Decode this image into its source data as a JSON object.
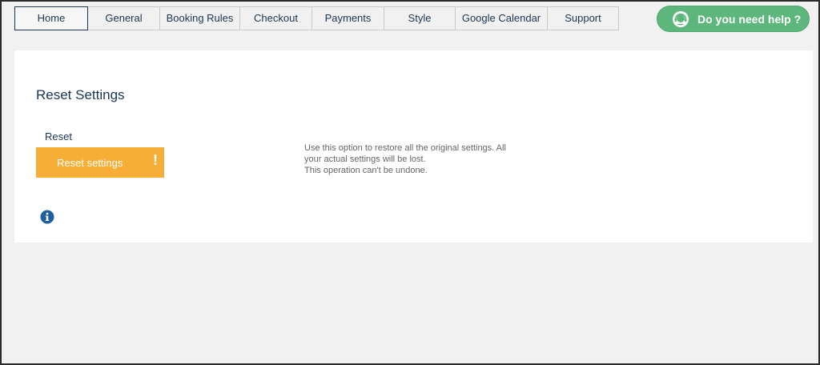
{
  "tabs": [
    {
      "label": "Home",
      "active": true
    },
    {
      "label": "General",
      "active": false
    },
    {
      "label": "Booking Rules",
      "active": false
    },
    {
      "label": "Checkout",
      "active": false
    },
    {
      "label": "Payments",
      "active": false
    },
    {
      "label": "Style",
      "active": false
    },
    {
      "label": "Google Calendar",
      "active": false
    },
    {
      "label": "Support",
      "active": false
    }
  ],
  "help_button": {
    "label": "Do you need help ?",
    "icon": "headset-support-icon",
    "color": "#5db77d"
  },
  "panel": {
    "title": "Reset Settings",
    "field_label": "Reset",
    "reset_button": {
      "label": "Reset settings",
      "icon": "exclamation-icon",
      "color": "#f6ae37"
    },
    "description_lines": [
      "Use this option to restore all the original settings. All",
      "your actual settings will be lost.",
      "This operation can't be undone."
    ],
    "info_icon": "info-icon"
  },
  "colors": {
    "accent": "#1c3553",
    "background": "#f1f1f1"
  }
}
